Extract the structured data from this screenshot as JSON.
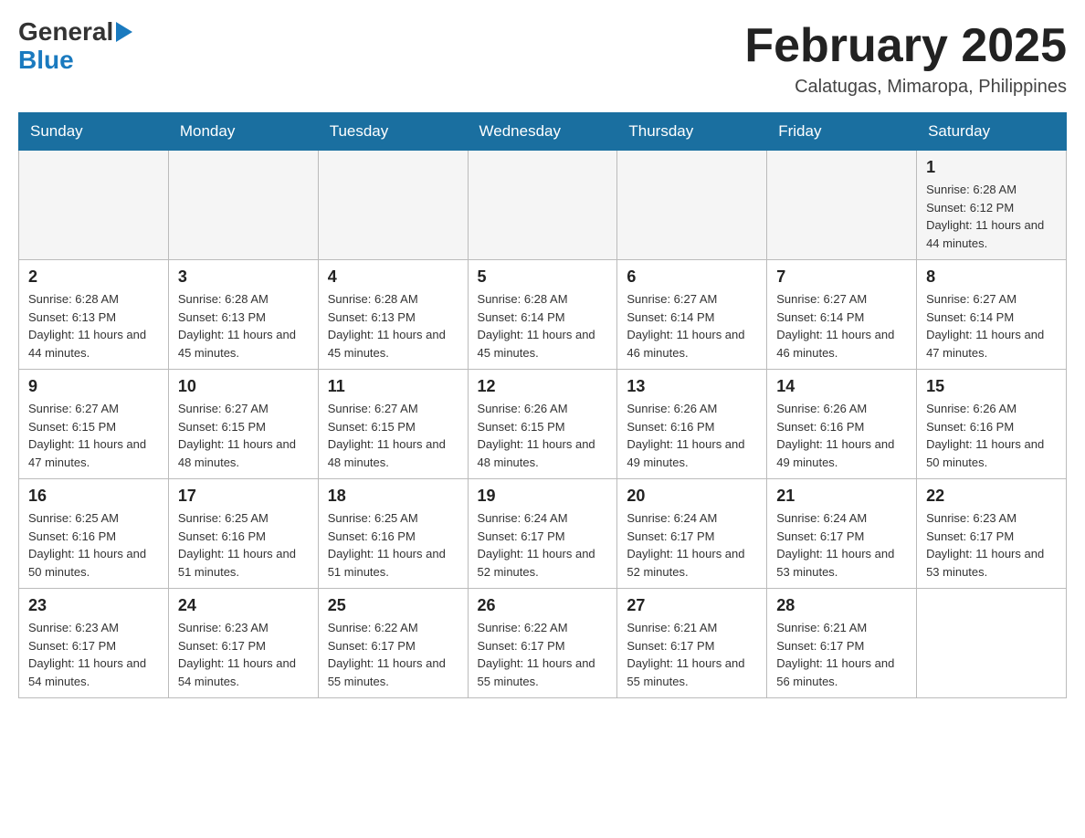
{
  "header": {
    "month_title": "February 2025",
    "location": "Calatugas, Mimaropa, Philippines",
    "logo_general": "General",
    "logo_blue": "Blue"
  },
  "weekdays": [
    "Sunday",
    "Monday",
    "Tuesday",
    "Wednesday",
    "Thursday",
    "Friday",
    "Saturday"
  ],
  "weeks": [
    {
      "days": [
        {
          "number": "",
          "info": ""
        },
        {
          "number": "",
          "info": ""
        },
        {
          "number": "",
          "info": ""
        },
        {
          "number": "",
          "info": ""
        },
        {
          "number": "",
          "info": ""
        },
        {
          "number": "",
          "info": ""
        },
        {
          "number": "1",
          "info": "Sunrise: 6:28 AM\nSunset: 6:12 PM\nDaylight: 11 hours\nand 44 minutes."
        }
      ]
    },
    {
      "days": [
        {
          "number": "2",
          "info": "Sunrise: 6:28 AM\nSunset: 6:13 PM\nDaylight: 11 hours\nand 44 minutes."
        },
        {
          "number": "3",
          "info": "Sunrise: 6:28 AM\nSunset: 6:13 PM\nDaylight: 11 hours\nand 45 minutes."
        },
        {
          "number": "4",
          "info": "Sunrise: 6:28 AM\nSunset: 6:13 PM\nDaylight: 11 hours\nand 45 minutes."
        },
        {
          "number": "5",
          "info": "Sunrise: 6:28 AM\nSunset: 6:14 PM\nDaylight: 11 hours\nand 45 minutes."
        },
        {
          "number": "6",
          "info": "Sunrise: 6:27 AM\nSunset: 6:14 PM\nDaylight: 11 hours\nand 46 minutes."
        },
        {
          "number": "7",
          "info": "Sunrise: 6:27 AM\nSunset: 6:14 PM\nDaylight: 11 hours\nand 46 minutes."
        },
        {
          "number": "8",
          "info": "Sunrise: 6:27 AM\nSunset: 6:14 PM\nDaylight: 11 hours\nand 47 minutes."
        }
      ]
    },
    {
      "days": [
        {
          "number": "9",
          "info": "Sunrise: 6:27 AM\nSunset: 6:15 PM\nDaylight: 11 hours\nand 47 minutes."
        },
        {
          "number": "10",
          "info": "Sunrise: 6:27 AM\nSunset: 6:15 PM\nDaylight: 11 hours\nand 48 minutes."
        },
        {
          "number": "11",
          "info": "Sunrise: 6:27 AM\nSunset: 6:15 PM\nDaylight: 11 hours\nand 48 minutes."
        },
        {
          "number": "12",
          "info": "Sunrise: 6:26 AM\nSunset: 6:15 PM\nDaylight: 11 hours\nand 48 minutes."
        },
        {
          "number": "13",
          "info": "Sunrise: 6:26 AM\nSunset: 6:16 PM\nDaylight: 11 hours\nand 49 minutes."
        },
        {
          "number": "14",
          "info": "Sunrise: 6:26 AM\nSunset: 6:16 PM\nDaylight: 11 hours\nand 49 minutes."
        },
        {
          "number": "15",
          "info": "Sunrise: 6:26 AM\nSunset: 6:16 PM\nDaylight: 11 hours\nand 50 minutes."
        }
      ]
    },
    {
      "days": [
        {
          "number": "16",
          "info": "Sunrise: 6:25 AM\nSunset: 6:16 PM\nDaylight: 11 hours\nand 50 minutes."
        },
        {
          "number": "17",
          "info": "Sunrise: 6:25 AM\nSunset: 6:16 PM\nDaylight: 11 hours\nand 51 minutes."
        },
        {
          "number": "18",
          "info": "Sunrise: 6:25 AM\nSunset: 6:16 PM\nDaylight: 11 hours\nand 51 minutes."
        },
        {
          "number": "19",
          "info": "Sunrise: 6:24 AM\nSunset: 6:17 PM\nDaylight: 11 hours\nand 52 minutes."
        },
        {
          "number": "20",
          "info": "Sunrise: 6:24 AM\nSunset: 6:17 PM\nDaylight: 11 hours\nand 52 minutes."
        },
        {
          "number": "21",
          "info": "Sunrise: 6:24 AM\nSunset: 6:17 PM\nDaylight: 11 hours\nand 53 minutes."
        },
        {
          "number": "22",
          "info": "Sunrise: 6:23 AM\nSunset: 6:17 PM\nDaylight: 11 hours\nand 53 minutes."
        }
      ]
    },
    {
      "days": [
        {
          "number": "23",
          "info": "Sunrise: 6:23 AM\nSunset: 6:17 PM\nDaylight: 11 hours\nand 54 minutes."
        },
        {
          "number": "24",
          "info": "Sunrise: 6:23 AM\nSunset: 6:17 PM\nDaylight: 11 hours\nand 54 minutes."
        },
        {
          "number": "25",
          "info": "Sunrise: 6:22 AM\nSunset: 6:17 PM\nDaylight: 11 hours\nand 55 minutes."
        },
        {
          "number": "26",
          "info": "Sunrise: 6:22 AM\nSunset: 6:17 PM\nDaylight: 11 hours\nand 55 minutes."
        },
        {
          "number": "27",
          "info": "Sunrise: 6:21 AM\nSunset: 6:17 PM\nDaylight: 11 hours\nand 55 minutes."
        },
        {
          "number": "28",
          "info": "Sunrise: 6:21 AM\nSunset: 6:17 PM\nDaylight: 11 hours\nand 56 minutes."
        },
        {
          "number": "",
          "info": ""
        }
      ]
    }
  ]
}
